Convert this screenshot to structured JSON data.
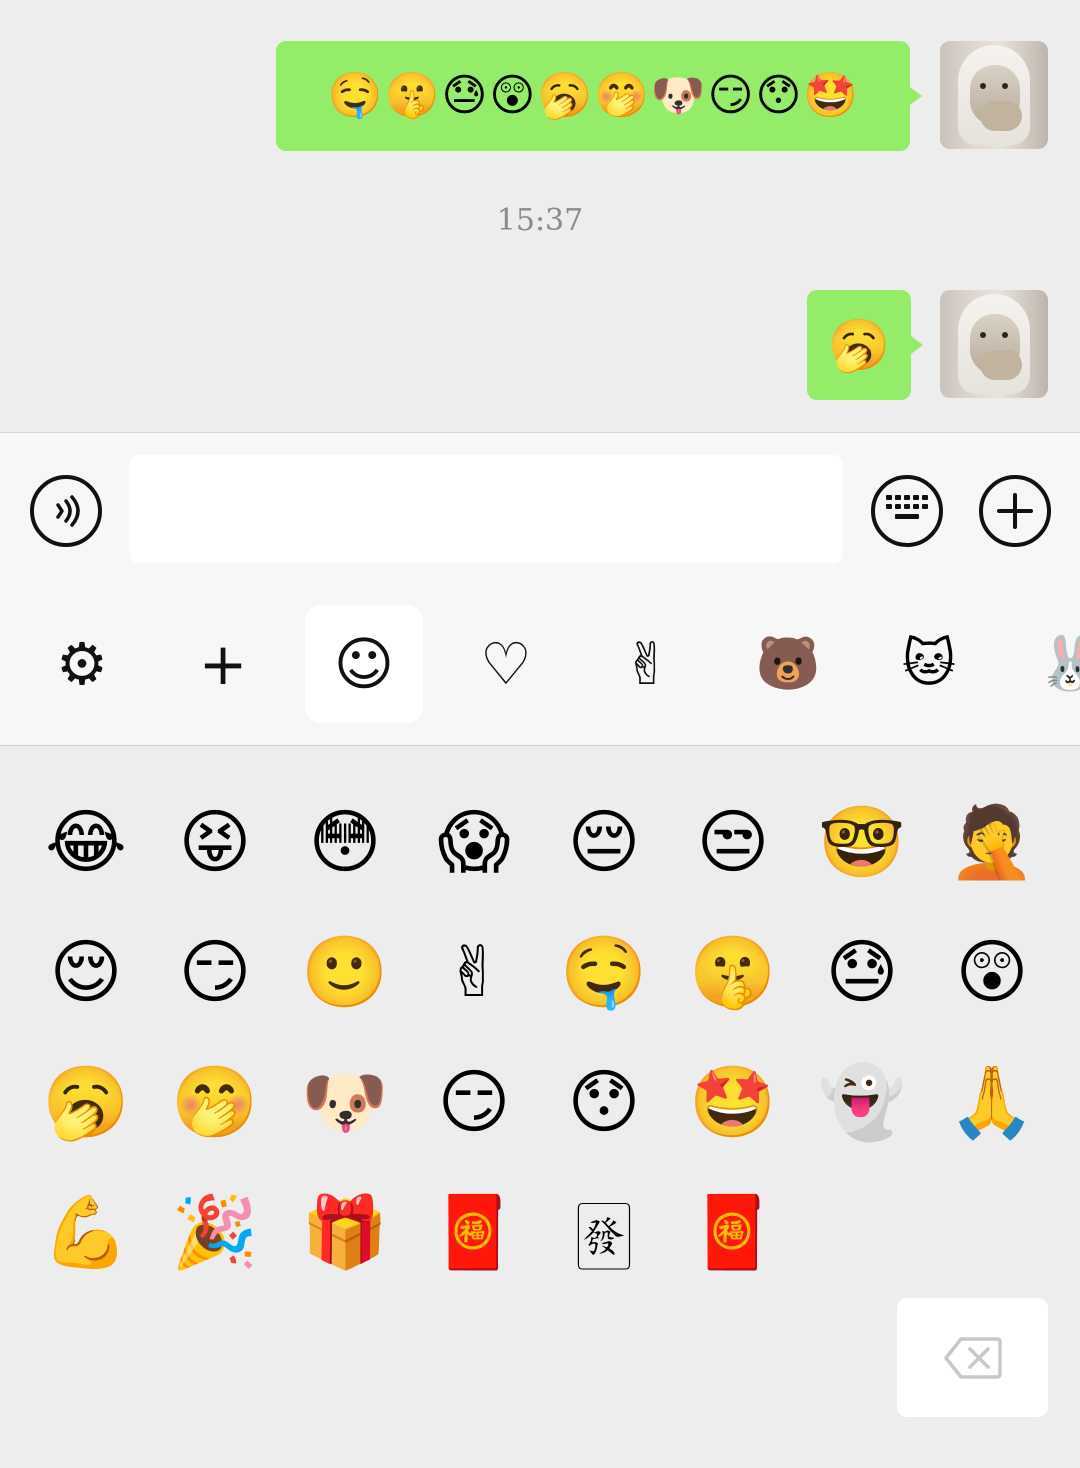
{
  "chat": {
    "timestamp": "15:37",
    "messages": [
      {
        "id": "msg1",
        "emojis": [
          "🤤",
          "🤫",
          "😓",
          "😲",
          "🥱",
          "🤭",
          "🐶",
          "😏",
          "😯",
          "🤩"
        ]
      },
      {
        "id": "msg2",
        "emojis": [
          "🥱"
        ]
      }
    ]
  },
  "input_bar": {
    "text_value": "",
    "voice_icon": "voice-icon",
    "keyboard_icon": "keyboard-icon",
    "plus_icon": "plus-circle-icon"
  },
  "sticker_tabs": [
    {
      "name": "settings",
      "glyph": "⚙",
      "icon": "gear-icon"
    },
    {
      "name": "add",
      "glyph": "+",
      "icon": "plus-icon"
    },
    {
      "name": "emoji",
      "glyph": "☺",
      "icon": "smiley-icon",
      "active": true
    },
    {
      "name": "favorites",
      "glyph": "♡",
      "icon": "heart-icon"
    },
    {
      "name": "gestures",
      "glyph": "✌",
      "icon": "victory-hand-icon"
    },
    {
      "name": "bears-pack",
      "glyph": "🐻",
      "icon": "bear-sticker-pack-icon"
    },
    {
      "name": "cat-pack",
      "glyph": "🐱",
      "icon": "cat-sticker-pack-icon"
    },
    {
      "name": "rabbit-pack",
      "glyph": "🐰",
      "icon": "rabbit-sticker-pack-icon"
    }
  ],
  "emoji_grid": [
    [
      "😂",
      "😝",
      "😳",
      "😱",
      "😔",
      "😒",
      "🤓",
      "🤦"
    ],
    [
      "😌",
      "😏",
      "🙂",
      "✌",
      "🤤",
      "🤫",
      "😓",
      "😲"
    ],
    [
      "🥱",
      "🤭",
      "🐶",
      "😏",
      "😯",
      "🤩",
      "👻",
      "🙏"
    ],
    [
      "💪",
      "🎉",
      "🎁",
      "🧧",
      "🀅",
      "🧧"
    ]
  ],
  "delete_key": {
    "icon": "backspace-icon"
  }
}
